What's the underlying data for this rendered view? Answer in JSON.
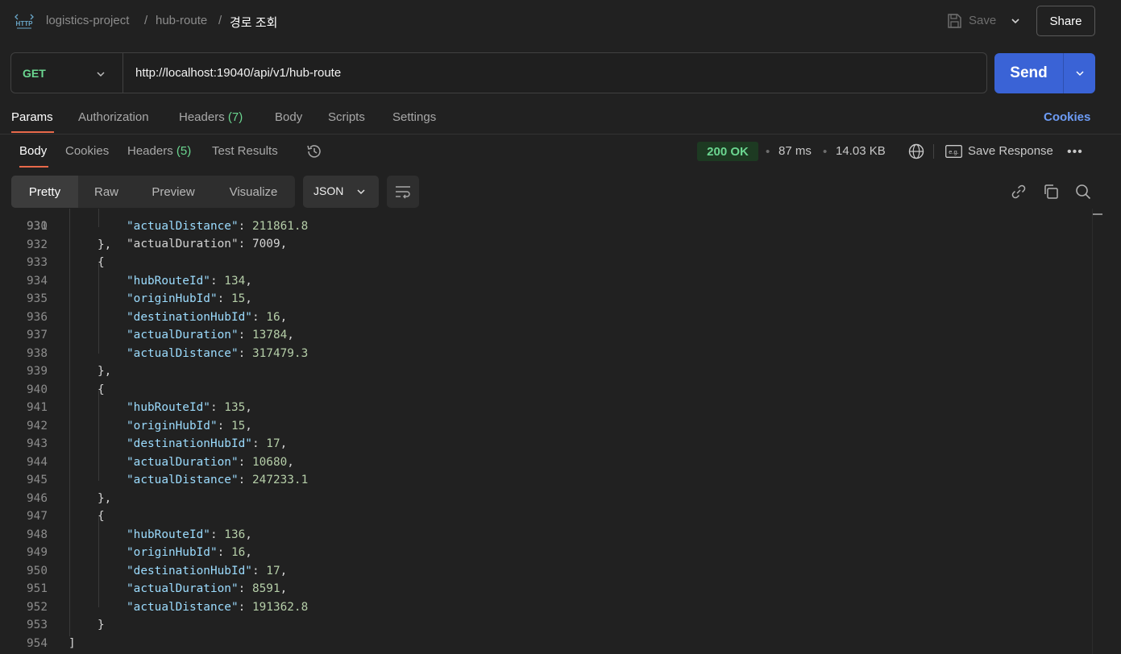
{
  "header": {
    "breadcrumb": [
      "logistics-project",
      "hub-route",
      "경로 조회"
    ],
    "separator": "/",
    "save_label": "Save",
    "share_label": "Share"
  },
  "request": {
    "method": "GET",
    "url": "http://localhost:19040/api/v1/hub-route",
    "send_label": "Send"
  },
  "request_tabs": {
    "params": "Params",
    "authorization": "Authorization",
    "headers": "Headers",
    "headers_count": "(7)",
    "body": "Body",
    "scripts": "Scripts",
    "settings": "Settings",
    "cookies": "Cookies"
  },
  "response_tabs": {
    "body": "Body",
    "cookies": "Cookies",
    "headers": "Headers",
    "headers_count": "(5)",
    "test_results": "Test Results"
  },
  "response_meta": {
    "status": "200 OK",
    "time": "87 ms",
    "size": "14.03 KB",
    "save_response": "Save Response",
    "dot": "•"
  },
  "view": {
    "modes": [
      "Pretty",
      "Raw",
      "Preview",
      "Visualize"
    ],
    "active_mode": "Pretty",
    "format": "JSON"
  },
  "code": {
    "partial_top": "\"actualDuration\": 7009,",
    "lines": [
      {
        "n": "931",
        "indent": 2,
        "key": "actualDistance",
        "value": "211861.8",
        "comma": false
      },
      {
        "n": "932",
        "indent": 1,
        "text": "},"
      },
      {
        "n": "933",
        "indent": 1,
        "text": "{"
      },
      {
        "n": "934",
        "indent": 2,
        "key": "hubRouteId",
        "value": "134",
        "comma": true
      },
      {
        "n": "935",
        "indent": 2,
        "key": "originHubId",
        "value": "15",
        "comma": true
      },
      {
        "n": "936",
        "indent": 2,
        "key": "destinationHubId",
        "value": "16",
        "comma": true
      },
      {
        "n": "937",
        "indent": 2,
        "key": "actualDuration",
        "value": "13784",
        "comma": true
      },
      {
        "n": "938",
        "indent": 2,
        "key": "actualDistance",
        "value": "317479.3",
        "comma": false
      },
      {
        "n": "939",
        "indent": 1,
        "text": "},"
      },
      {
        "n": "940",
        "indent": 1,
        "text": "{"
      },
      {
        "n": "941",
        "indent": 2,
        "key": "hubRouteId",
        "value": "135",
        "comma": true
      },
      {
        "n": "942",
        "indent": 2,
        "key": "originHubId",
        "value": "15",
        "comma": true
      },
      {
        "n": "943",
        "indent": 2,
        "key": "destinationHubId",
        "value": "17",
        "comma": true
      },
      {
        "n": "944",
        "indent": 2,
        "key": "actualDuration",
        "value": "10680",
        "comma": true
      },
      {
        "n": "945",
        "indent": 2,
        "key": "actualDistance",
        "value": "247233.1",
        "comma": false
      },
      {
        "n": "946",
        "indent": 1,
        "text": "},"
      },
      {
        "n": "947",
        "indent": 1,
        "text": "{"
      },
      {
        "n": "948",
        "indent": 2,
        "key": "hubRouteId",
        "value": "136",
        "comma": true
      },
      {
        "n": "949",
        "indent": 2,
        "key": "originHubId",
        "value": "16",
        "comma": true
      },
      {
        "n": "950",
        "indent": 2,
        "key": "destinationHubId",
        "value": "17",
        "comma": true
      },
      {
        "n": "951",
        "indent": 2,
        "key": "actualDuration",
        "value": "8591",
        "comma": true
      },
      {
        "n": "952",
        "indent": 2,
        "key": "actualDistance",
        "value": "191362.8",
        "comma": false
      },
      {
        "n": "953",
        "indent": 1,
        "text": "}"
      },
      {
        "n": "954",
        "indent": 0,
        "text": "]"
      }
    ]
  },
  "colors": {
    "accent": "#e8694a",
    "send": "#3a63d6",
    "method_get": "#6bd690",
    "status_ok": "#6bd690",
    "link": "#6d9cf5"
  },
  "icons": [
    "http-icon",
    "save-icon",
    "chevron-down-icon",
    "history-icon",
    "globe-icon",
    "example-icon",
    "more-icon",
    "wrap-lines-icon",
    "link-icon",
    "copy-icon",
    "search-icon"
  ]
}
